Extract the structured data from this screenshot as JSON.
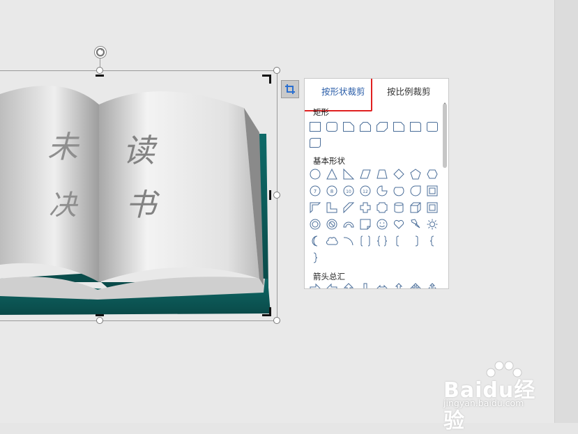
{
  "menu": {
    "tabs": [
      {
        "label": "按形状裁剪",
        "active": true
      },
      {
        "label": "按比例裁剪",
        "active": false
      }
    ],
    "sections": [
      {
        "title": "矩形"
      },
      {
        "title": "基本形状"
      },
      {
        "title": "箭头总汇"
      }
    ],
    "highlight_color": "#e02020"
  },
  "book": {
    "left_page_text": [
      "未",
      "决"
    ],
    "right_page_text": [
      "读",
      "书"
    ],
    "cover_color": "#0f5b5a"
  },
  "watermark": {
    "brand": "Baidu经验",
    "url": "jingyan.baidu.com"
  },
  "icons": {
    "crop": "crop-icon",
    "rotate": "rotate-icon"
  }
}
